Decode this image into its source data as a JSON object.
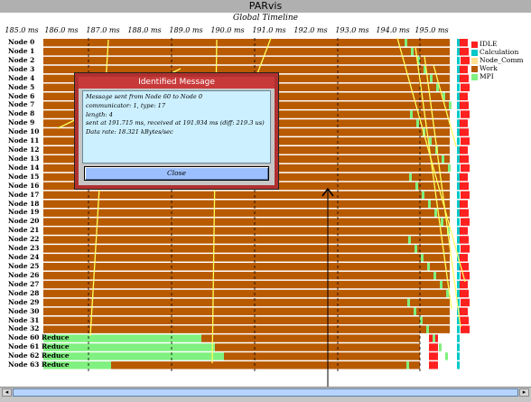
{
  "window": {
    "title": "PARvis"
  },
  "timeline": {
    "title": "Global Timeline",
    "ticks": [
      "185.0 ms",
      "186.0 ms",
      "187.0 ms",
      "188.0 ms",
      "189.0 ms",
      "190.0 ms",
      "191.0 ms",
      "192.0 ms",
      "193.0 ms",
      "194.0 ms",
      "195.0 ms"
    ]
  },
  "nodes": [
    "Node 0",
    "Node 1",
    "Node 2",
    "Node 3",
    "Node 4",
    "Node 5",
    "Node 6",
    "Node 7",
    "Node 8",
    "Node 9",
    "Node 10",
    "Node 11",
    "Node 12",
    "Node 13",
    "Node 14",
    "Node 15",
    "Node 16",
    "Node 17",
    "Node 18",
    "Node 19",
    "Node 20",
    "Node 21",
    "Node 22",
    "Node 23",
    "Node 24",
    "Node 25",
    "Node 26",
    "Node 27",
    "Node 28",
    "Node 29",
    "Node 30",
    "Node 31",
    "Node 32",
    "Node 60 Reduce",
    "Node 61 Reduce",
    "Node 62 Reduce",
    "Node 63 Reduce"
  ],
  "legend": {
    "items": [
      {
        "label": "IDLE",
        "color": "#ff2020"
      },
      {
        "label": "Calculation",
        "color": "#00c8c8"
      },
      {
        "label": "Node_Comm",
        "color": "#ffe090"
      },
      {
        "label": "Work",
        "color": "#b85a00"
      },
      {
        "label": "MPI",
        "color": "#80f080"
      }
    ]
  },
  "colors": {
    "work": "#b85a00",
    "idle": "#ff2020",
    "reduce": "#80f080",
    "message": "#ffff60",
    "calc": "#00c8c8"
  },
  "dialog": {
    "title": "Identified Message",
    "lines": [
      "Message sent from Node 60 to Node 0",
      "communicator: 1, type: 17",
      "length: 4",
      "sent at 191.715 ms, received at 191.934 ms (diff: 219.3 us)",
      "Data rate: 18.321 kBytes/sec"
    ],
    "close_label": "Close"
  }
}
